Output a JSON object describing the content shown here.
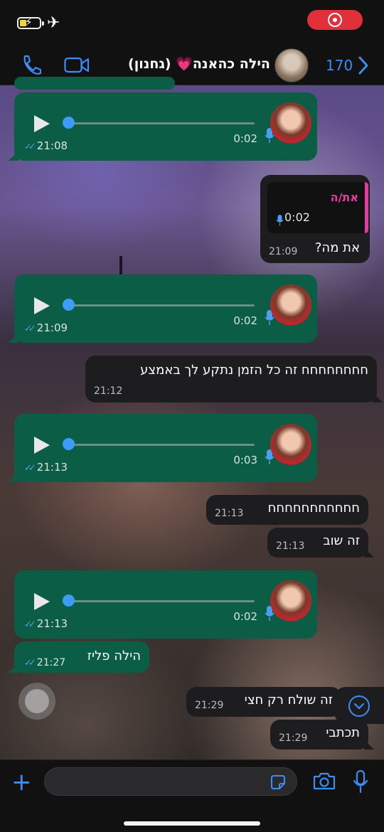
{
  "status_bar": {
    "battery": "charging",
    "airplane_mode": true,
    "screen_recording": true,
    "accent": "#e0303a"
  },
  "header": {
    "contact_name": "הילה כהאנה💗 (גחנון)",
    "unread_count": "170",
    "icons": [
      "phone-icon",
      "video-icon",
      "chevron-right-icon"
    ],
    "accent": "#3e8cf5"
  },
  "messages": [
    {
      "type": "voice",
      "direction": "out",
      "duration": "0:02",
      "time": "21:08",
      "read": true
    },
    {
      "type": "text",
      "direction": "in",
      "reply_to_author": "את/ה",
      "reply_to_duration": "0:02",
      "text": "את מה?",
      "time": "21:09"
    },
    {
      "type": "voice",
      "direction": "out",
      "duration": "0:02",
      "time": "21:09",
      "read": true
    },
    {
      "type": "text",
      "direction": "in",
      "text": "חחחחחחחח זה כל הזמן נתקע לך באמצע",
      "time": "21:12"
    },
    {
      "type": "voice",
      "direction": "out",
      "duration": "0:03",
      "time": "21:13",
      "read": true
    },
    {
      "type": "text",
      "direction": "in",
      "text": "חחחחחחחחחחח",
      "time": "21:13"
    },
    {
      "type": "text",
      "direction": "in",
      "text": "זה שוב",
      "time": "21:13"
    },
    {
      "type": "voice",
      "direction": "out",
      "duration": "0:02",
      "time": "21:13",
      "read": true
    },
    {
      "type": "text",
      "direction": "out",
      "text": "הילה פליז",
      "time": "21:27",
      "read": true
    },
    {
      "type": "text",
      "direction": "in",
      "text": "זה שולח רק חצי",
      "time": "21:29"
    },
    {
      "type": "text",
      "direction": "in",
      "text": "תכתבי",
      "time": "21:29"
    }
  ],
  "input_bar": {
    "placeholder": "",
    "icons": [
      "plus-icon",
      "sticker-icon",
      "camera-icon",
      "microphone-icon"
    ]
  },
  "colors": {
    "outgoing_bubble": "#0b5d45",
    "incoming_bubble": "#1d1d1f",
    "read_ticks": "#4a9ff5",
    "reply_accent": "#e63ba3"
  }
}
